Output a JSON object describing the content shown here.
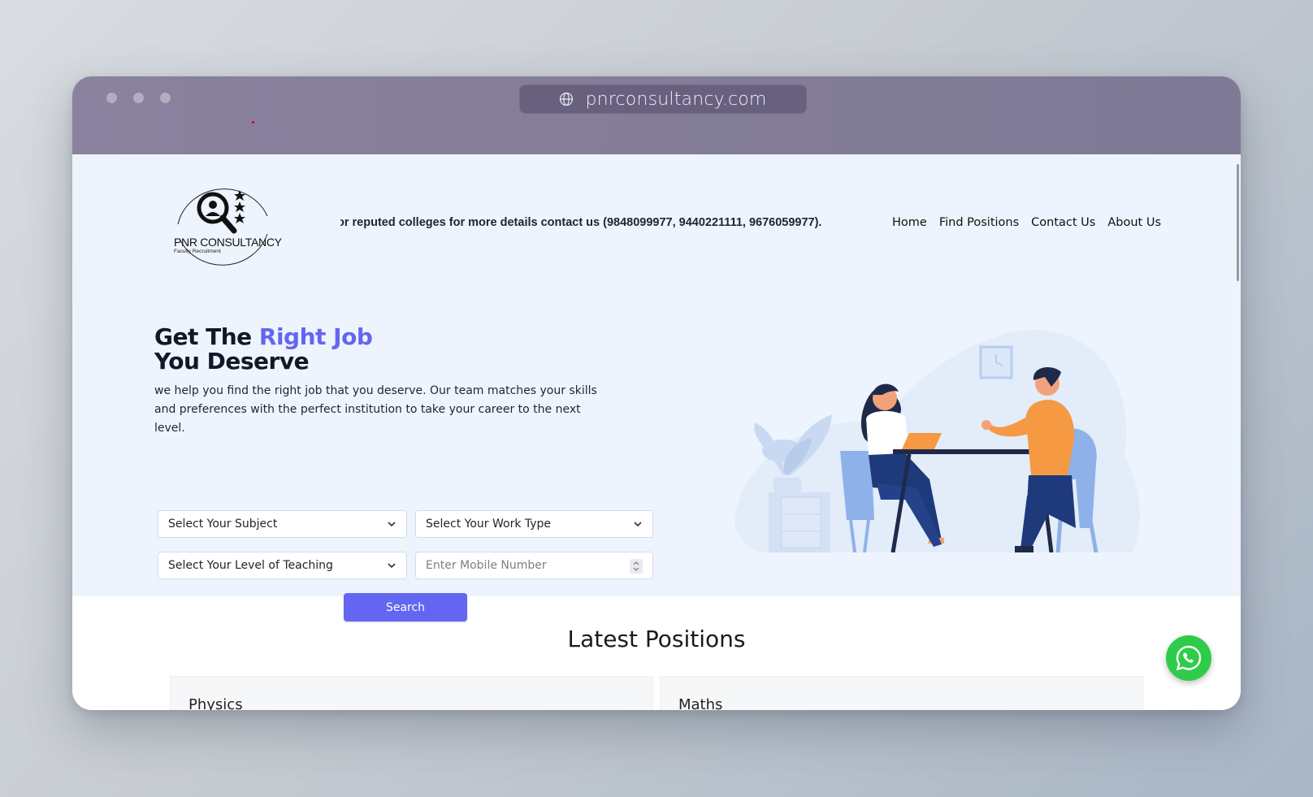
{
  "browser": {
    "url": "pnrconsultancy.com"
  },
  "logo": {
    "name": "PNR CONSULTANCY",
    "tagline": "Faculty Recruitment"
  },
  "ticker": {
    "text": "or reputed colleges for more details contact us (9848099977, 9440221111, 9676059977)."
  },
  "nav": {
    "items": [
      {
        "label": "Home"
      },
      {
        "label": "Find Positions"
      },
      {
        "label": "Contact Us"
      },
      {
        "label": "About Us"
      }
    ]
  },
  "hero": {
    "title_part1": "Get The ",
    "title_accent": "Right Job",
    "title_part2": "You Deserve",
    "description": "we help you find the right job that you deserve. Our team matches your skills and preferences with the perfect institution to take your career to the next level."
  },
  "form": {
    "subject_select": "Select Your Subject",
    "work_type_select": "Select Your Work Type",
    "level_select": "Select Your Level of Teaching",
    "mobile_placeholder": "Enter Mobile Number",
    "search_label": "Search"
  },
  "latest": {
    "title": "Latest Positions",
    "cards": [
      {
        "title": "Physics"
      },
      {
        "title": "Maths"
      }
    ]
  },
  "colors": {
    "accent": "#6366f1",
    "hero_bg": "#eef4fd",
    "whatsapp": "#2ecc4a"
  }
}
